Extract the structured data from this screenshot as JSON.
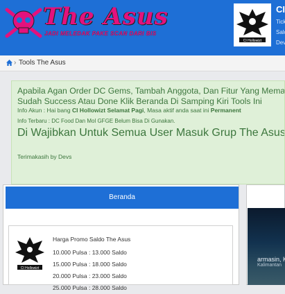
{
  "header": {
    "brand": "The Asus",
    "tagline": "JADI MELEDAK PAKE SCAN DARI BIS",
    "profile_name": "CI H",
    "profile_lines": [
      "Ticke",
      "Sald",
      "Dev"
    ],
    "profile_caption": "CI Hollowizt"
  },
  "breadcrumb": {
    "current": "Tools The Asus"
  },
  "alert": {
    "line1": "Apabila Agan Order DC Gems, Tambah Anggota, Dan Fitur Yang Memakai Saldo Dan Tike",
    "line2": "Sudah Success Atau Done Klik Beranda Di Samping Kiri Tools Ini",
    "info_prefix": "Info Akun : Hai bang",
    "info_name": "CI Hollowizt Selamat Pagi",
    "info_mid": ", Masa aktif anda saat ini",
    "info_status": "Permanent",
    "info_news": "Info Terbaru : DC Food Dan Mol GFGE Belum Bisa Di Gunakan.",
    "headline": "Di Wajibkan Untuk Semua User Masuk Grup The Asus",
    "thanks": "Terimakasih by Devs"
  },
  "panel": {
    "title": "Beranda",
    "promo_caption": "CI Hollowizt",
    "promo_title": "Harga Promo Saldo The Asus",
    "promo_items": [
      "10.000 Pulsa : 13.000 Saldo",
      "15.000 Pulsa : 18.000 Saldo",
      "20.000 Pulsa : 23.000 Saldo",
      "25.000 Pulsa : 28.000 Saldo"
    ]
  },
  "map": {
    "city": "armasin, Ka",
    "sub": "Kalimantan"
  }
}
